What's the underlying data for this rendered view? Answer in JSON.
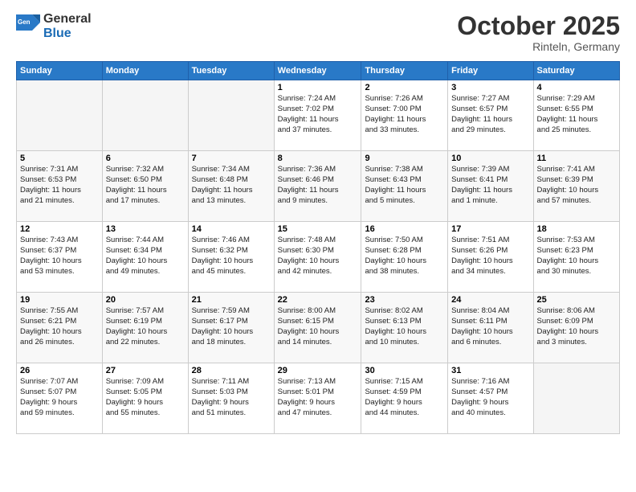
{
  "logo": {
    "line1": "General",
    "line2": "Blue"
  },
  "title": "October 2025",
  "location": "Rinteln, Germany",
  "days_of_week": [
    "Sunday",
    "Monday",
    "Tuesday",
    "Wednesday",
    "Thursday",
    "Friday",
    "Saturday"
  ],
  "weeks": [
    [
      {
        "day": "",
        "info": ""
      },
      {
        "day": "",
        "info": ""
      },
      {
        "day": "",
        "info": ""
      },
      {
        "day": "1",
        "info": "Sunrise: 7:24 AM\nSunset: 7:02 PM\nDaylight: 11 hours\nand 37 minutes."
      },
      {
        "day": "2",
        "info": "Sunrise: 7:26 AM\nSunset: 7:00 PM\nDaylight: 11 hours\nand 33 minutes."
      },
      {
        "day": "3",
        "info": "Sunrise: 7:27 AM\nSunset: 6:57 PM\nDaylight: 11 hours\nand 29 minutes."
      },
      {
        "day": "4",
        "info": "Sunrise: 7:29 AM\nSunset: 6:55 PM\nDaylight: 11 hours\nand 25 minutes."
      }
    ],
    [
      {
        "day": "5",
        "info": "Sunrise: 7:31 AM\nSunset: 6:53 PM\nDaylight: 11 hours\nand 21 minutes."
      },
      {
        "day": "6",
        "info": "Sunrise: 7:32 AM\nSunset: 6:50 PM\nDaylight: 11 hours\nand 17 minutes."
      },
      {
        "day": "7",
        "info": "Sunrise: 7:34 AM\nSunset: 6:48 PM\nDaylight: 11 hours\nand 13 minutes."
      },
      {
        "day": "8",
        "info": "Sunrise: 7:36 AM\nSunset: 6:46 PM\nDaylight: 11 hours\nand 9 minutes."
      },
      {
        "day": "9",
        "info": "Sunrise: 7:38 AM\nSunset: 6:43 PM\nDaylight: 11 hours\nand 5 minutes."
      },
      {
        "day": "10",
        "info": "Sunrise: 7:39 AM\nSunset: 6:41 PM\nDaylight: 11 hours\nand 1 minute."
      },
      {
        "day": "11",
        "info": "Sunrise: 7:41 AM\nSunset: 6:39 PM\nDaylight: 10 hours\nand 57 minutes."
      }
    ],
    [
      {
        "day": "12",
        "info": "Sunrise: 7:43 AM\nSunset: 6:37 PM\nDaylight: 10 hours\nand 53 minutes."
      },
      {
        "day": "13",
        "info": "Sunrise: 7:44 AM\nSunset: 6:34 PM\nDaylight: 10 hours\nand 49 minutes."
      },
      {
        "day": "14",
        "info": "Sunrise: 7:46 AM\nSunset: 6:32 PM\nDaylight: 10 hours\nand 45 minutes."
      },
      {
        "day": "15",
        "info": "Sunrise: 7:48 AM\nSunset: 6:30 PM\nDaylight: 10 hours\nand 42 minutes."
      },
      {
        "day": "16",
        "info": "Sunrise: 7:50 AM\nSunset: 6:28 PM\nDaylight: 10 hours\nand 38 minutes."
      },
      {
        "day": "17",
        "info": "Sunrise: 7:51 AM\nSunset: 6:26 PM\nDaylight: 10 hours\nand 34 minutes."
      },
      {
        "day": "18",
        "info": "Sunrise: 7:53 AM\nSunset: 6:23 PM\nDaylight: 10 hours\nand 30 minutes."
      }
    ],
    [
      {
        "day": "19",
        "info": "Sunrise: 7:55 AM\nSunset: 6:21 PM\nDaylight: 10 hours\nand 26 minutes."
      },
      {
        "day": "20",
        "info": "Sunrise: 7:57 AM\nSunset: 6:19 PM\nDaylight: 10 hours\nand 22 minutes."
      },
      {
        "day": "21",
        "info": "Sunrise: 7:59 AM\nSunset: 6:17 PM\nDaylight: 10 hours\nand 18 minutes."
      },
      {
        "day": "22",
        "info": "Sunrise: 8:00 AM\nSunset: 6:15 PM\nDaylight: 10 hours\nand 14 minutes."
      },
      {
        "day": "23",
        "info": "Sunrise: 8:02 AM\nSunset: 6:13 PM\nDaylight: 10 hours\nand 10 minutes."
      },
      {
        "day": "24",
        "info": "Sunrise: 8:04 AM\nSunset: 6:11 PM\nDaylight: 10 hours\nand 6 minutes."
      },
      {
        "day": "25",
        "info": "Sunrise: 8:06 AM\nSunset: 6:09 PM\nDaylight: 10 hours\nand 3 minutes."
      }
    ],
    [
      {
        "day": "26",
        "info": "Sunrise: 7:07 AM\nSunset: 5:07 PM\nDaylight: 9 hours\nand 59 minutes."
      },
      {
        "day": "27",
        "info": "Sunrise: 7:09 AM\nSunset: 5:05 PM\nDaylight: 9 hours\nand 55 minutes."
      },
      {
        "day": "28",
        "info": "Sunrise: 7:11 AM\nSunset: 5:03 PM\nDaylight: 9 hours\nand 51 minutes."
      },
      {
        "day": "29",
        "info": "Sunrise: 7:13 AM\nSunset: 5:01 PM\nDaylight: 9 hours\nand 47 minutes."
      },
      {
        "day": "30",
        "info": "Sunrise: 7:15 AM\nSunset: 4:59 PM\nDaylight: 9 hours\nand 44 minutes."
      },
      {
        "day": "31",
        "info": "Sunrise: 7:16 AM\nSunset: 4:57 PM\nDaylight: 9 hours\nand 40 minutes."
      },
      {
        "day": "",
        "info": ""
      }
    ]
  ]
}
